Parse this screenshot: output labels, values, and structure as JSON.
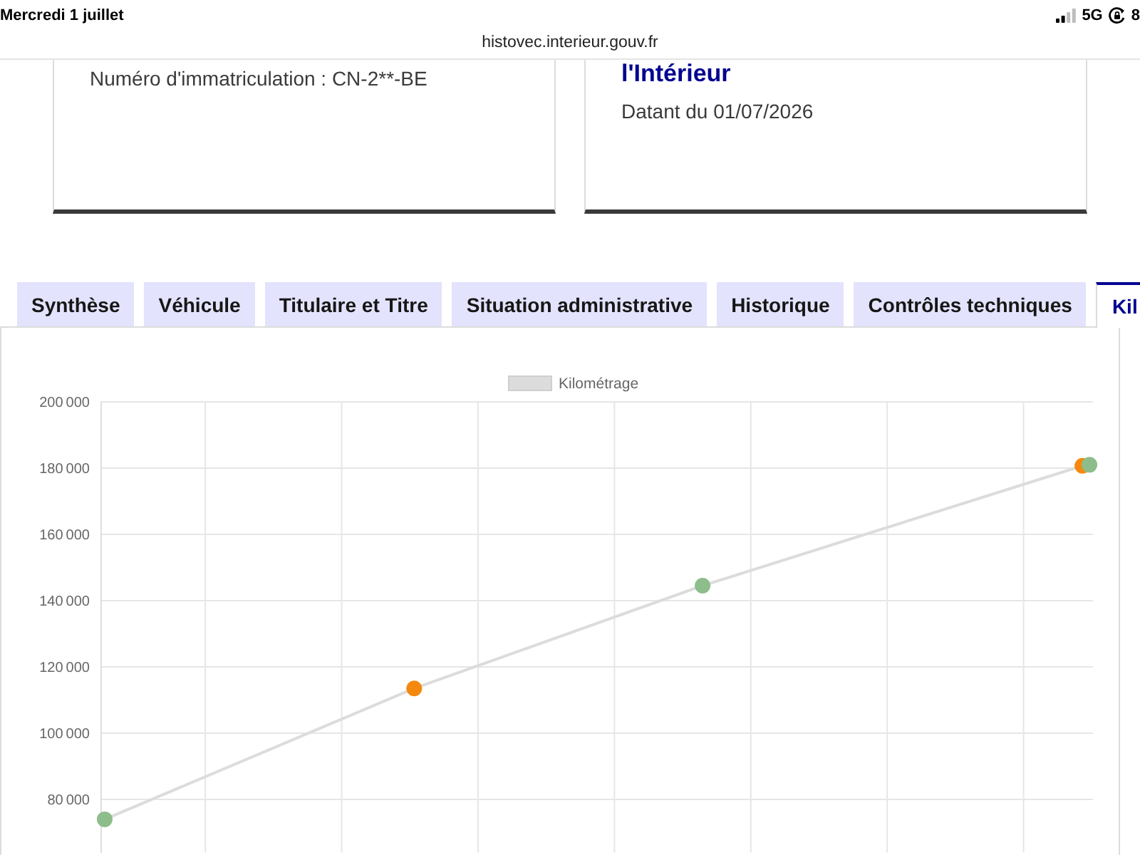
{
  "status_bar": {
    "date": "Mercredi 1 juillet",
    "network": "5G",
    "battery": "8"
  },
  "address_bar": {
    "url": "histovec.interieur.gouv.fr"
  },
  "cards": [
    {
      "text": "Numéro d'immatriculation : CN-2**-BE"
    },
    {
      "title": "l'Intérieur",
      "text": "Datant du 01/07/2026"
    }
  ],
  "tabs": [
    {
      "label": "Synthèse",
      "selected": false
    },
    {
      "label": "Véhicule",
      "selected": false
    },
    {
      "label": "Titulaire et Titre",
      "selected": false
    },
    {
      "label": "Situation administrative",
      "selected": false
    },
    {
      "label": "Historique",
      "selected": false
    },
    {
      "label": "Contrôles techniques",
      "selected": false
    },
    {
      "label": "Kil",
      "selected": true
    }
  ],
  "mileage_panel": {
    "chart_data": {
      "type": "line",
      "grid": true,
      "categories": [
        null,
        null,
        null,
        null,
        null,
        null,
        null,
        null,
        null,
        null,
        null,
        null,
        null,
        null,
        null,
        null,
        null,
        null,
        null,
        null,
        null,
        null,
        null,
        null,
        null,
        null,
        null,
        null,
        null,
        null,
        null,
        null,
        null,
        null,
        null,
        null,
        null,
        null,
        null,
        null,
        null,
        null,
        null,
        null,
        null,
        null,
        null,
        null,
        null,
        null,
        null,
        null,
        null,
        null,
        null,
        null,
        null,
        null,
        null,
        null,
        null,
        null,
        null,
        null,
        null,
        null,
        null,
        null,
        null,
        null,
        null,
        null,
        null,
        null,
        null,
        null,
        null,
        null,
        null,
        null,
        null,
        null,
        null,
        null,
        null,
        null,
        null,
        null,
        null,
        null,
        null,
        null,
        null,
        null,
        null,
        null,
        null,
        null,
        null,
        null,
        null,
        null,
        null,
        null,
        null,
        null,
        null,
        null,
        null,
        null,
        null,
        null,
        null,
        null,
        null,
        null,
        null,
        null,
        null,
        null,
        null,
        null,
        null,
        null,
        null,
        null,
        null,
        null,
        null,
        null,
        null,
        null,
        null,
        null,
        null,
        null,
        null,
        null,
        null,
        null,
        null
      ],
      "series": [
        {
          "name": "Kilométrage",
          "color": "#dcdcdc",
          "marker": "circle",
          "values": [
            74000,
            null,
            null,
            null,
            null,
            null,
            null,
            null,
            null,
            null,
            null,
            null,
            null,
            null,
            null,
            null,
            null,
            null,
            null,
            null,
            null,
            null,
            null,
            null,
            null,
            null,
            null,
            null,
            null,
            null,
            null,
            null,
            null,
            null,
            null,
            null,
            null,
            null,
            null,
            null,
            null,
            null,
            null,
            null,
            113500,
            null,
            null,
            null,
            null,
            null,
            null,
            null,
            null,
            null,
            null,
            null,
            null,
            null,
            null,
            null,
            null,
            null,
            null,
            null,
            null,
            null,
            null,
            null,
            null,
            null,
            null,
            null,
            null,
            null,
            null,
            null,
            null,
            null,
            null,
            null,
            null,
            null,
            null,
            null,
            null,
            144500,
            null,
            null,
            null,
            null,
            null,
            null,
            null,
            null,
            null,
            null,
            null,
            null,
            null,
            null,
            null,
            null,
            null,
            null,
            null,
            null,
            null,
            null,
            null,
            null,
            null,
            null,
            null,
            null,
            null,
            null,
            null,
            null,
            null,
            null,
            null,
            null,
            null,
            null,
            null,
            null,
            null,
            null,
            null,
            null,
            null,
            null,
            null,
            null,
            null,
            null,
            null,
            null,
            null,
            180700,
            181000
          ]
        }
      ],
      "ylim": [
        64000,
        200000
      ],
      "yticks": [
        {
          "value": 80000,
          "label": "80 000"
        },
        {
          "value": 100000,
          "label": "100 000"
        },
        {
          "value": 120000,
          "label": "120 000"
        },
        {
          "value": 140000,
          "label": "140 000"
        },
        {
          "value": 160000,
          "label": "160 000"
        },
        {
          "value": 180000,
          "label": "180 000"
        },
        {
          "value": 200000,
          "label": "200 000"
        }
      ]
    },
    "point_markers": [
      {
        "color": "#8dbd8b"
      },
      {
        "color": "#f5890d"
      },
      {
        "color": "#8dbd8b"
      },
      {
        "color": "#f5890d"
      },
      {
        "color": "#8dbd8b"
      }
    ]
  }
}
